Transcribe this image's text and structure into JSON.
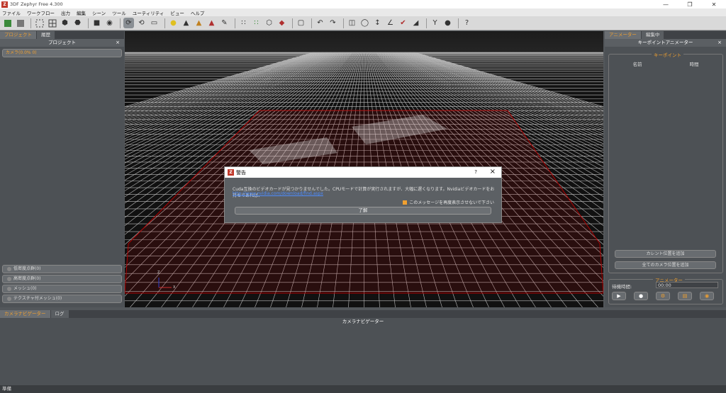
{
  "window": {
    "title": "3DF Zephyr Free 4.300",
    "logo_letter": "Z"
  },
  "menu": [
    "ファイル",
    "ワークフロー",
    "出力",
    "編集",
    "シーン",
    "ツール",
    "ユーティリティ",
    "ビュー",
    "ヘルプ"
  ],
  "left_panel": {
    "tabs": [
      "プロジェクト",
      "履歴"
    ],
    "header": "プロジェクト",
    "camera_item": "カメラ(0.0% 0)",
    "buttons": [
      "低密度点群(0)",
      "高密度点群(0)",
      "メッシュ(0)",
      "テクスチャ付メッシュ(0)"
    ]
  },
  "right_panel": {
    "tabs": [
      "アニメーター",
      "編集中"
    ],
    "header": "キーポイントアニメーター",
    "keypoint_legend": "キーポイント",
    "col_name": "名前",
    "col_time": "時間",
    "add_current": "カレント位置を追加",
    "add_all": "全てのカメラ位置を追加",
    "anim_legend": "アニメーター",
    "wait_label": "待機時間:",
    "wait_value": "00:00"
  },
  "viewport": {
    "axis_z": "Z",
    "axis_x": "X"
  },
  "bottom_panel": {
    "tabs": [
      "カメラナビゲーター",
      "ログ"
    ],
    "header": "カメラナビゲーター"
  },
  "status": "準備",
  "dialog": {
    "title": "警告",
    "message": "Cuda互換のビデオカードが見つかりませんでした。CPUモードで計算が実行されますが、大幅に遅くなります。Nvidiaビデオカードをお持ちであれば、",
    "link": "http://www.nvidia.com/download/find.aspx",
    "checkbox": "このメッセージを再度表示させないで下さい",
    "ok": "了解",
    "help": "?"
  }
}
